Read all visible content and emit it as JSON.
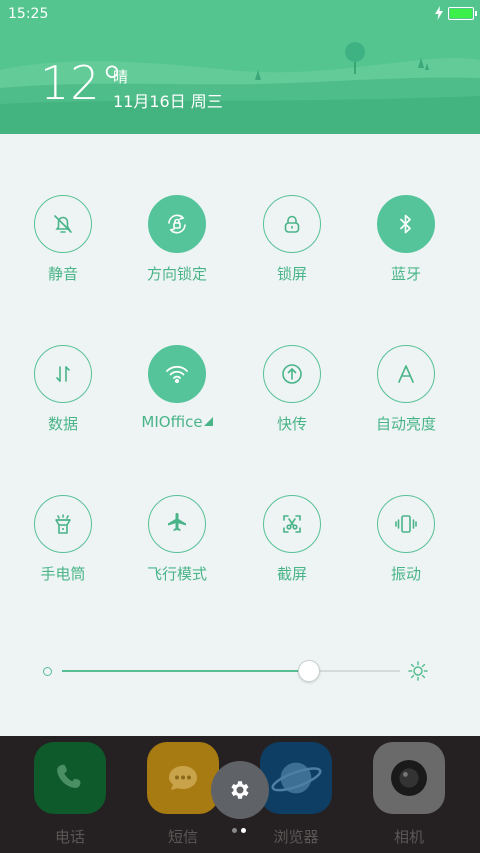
{
  "status_bar": {
    "time": "15:25",
    "battery_level": 1.0,
    "charging": true
  },
  "weather": {
    "temperature": "12°",
    "condition": "晴",
    "date": "11月16日 周三"
  },
  "toggles": [
    {
      "label": "静音",
      "icon": "mute-bell-icon",
      "on": false
    },
    {
      "label": "方向锁定",
      "icon": "rotation-lock-icon",
      "on": true
    },
    {
      "label": "锁屏",
      "icon": "lock-icon",
      "on": false
    },
    {
      "label": "蓝牙",
      "icon": "bluetooth-icon",
      "on": true
    },
    {
      "label": "数据",
      "icon": "mobile-data-icon",
      "on": false
    },
    {
      "label": "MIOffice",
      "icon": "wifi-icon",
      "on": true
    },
    {
      "label": "快传",
      "icon": "quick-transfer-icon",
      "on": false
    },
    {
      "label": "自动亮度",
      "icon": "auto-brightness-icon",
      "on": false
    },
    {
      "label": "手电筒",
      "icon": "flashlight-icon",
      "on": false
    },
    {
      "label": "飞行模式",
      "icon": "airplane-icon",
      "on": false
    },
    {
      "label": "截屏",
      "icon": "screenshot-icon",
      "on": false
    },
    {
      "label": "振动",
      "icon": "vibrate-icon",
      "on": false
    }
  ],
  "brightness": {
    "level": 0.73
  },
  "dock": {
    "apps": [
      {
        "label": "电话",
        "icon": "phone-icon",
        "color": "#0e5a2a"
      },
      {
        "label": "短信",
        "icon": "message-icon",
        "color": "#a87a12"
      },
      {
        "label": "浏览器",
        "icon": "browser-icon",
        "color": "#0e3e63"
      },
      {
        "label": "相机",
        "icon": "camera-icon",
        "color": "#6a6a6a"
      }
    ],
    "settings_icon": "gear-icon",
    "pages": 2,
    "current_page": 2
  },
  "colors": {
    "accent": "#55c49a",
    "header": "#55c590",
    "panel": "#eef4f4",
    "dock": "#252122"
  }
}
